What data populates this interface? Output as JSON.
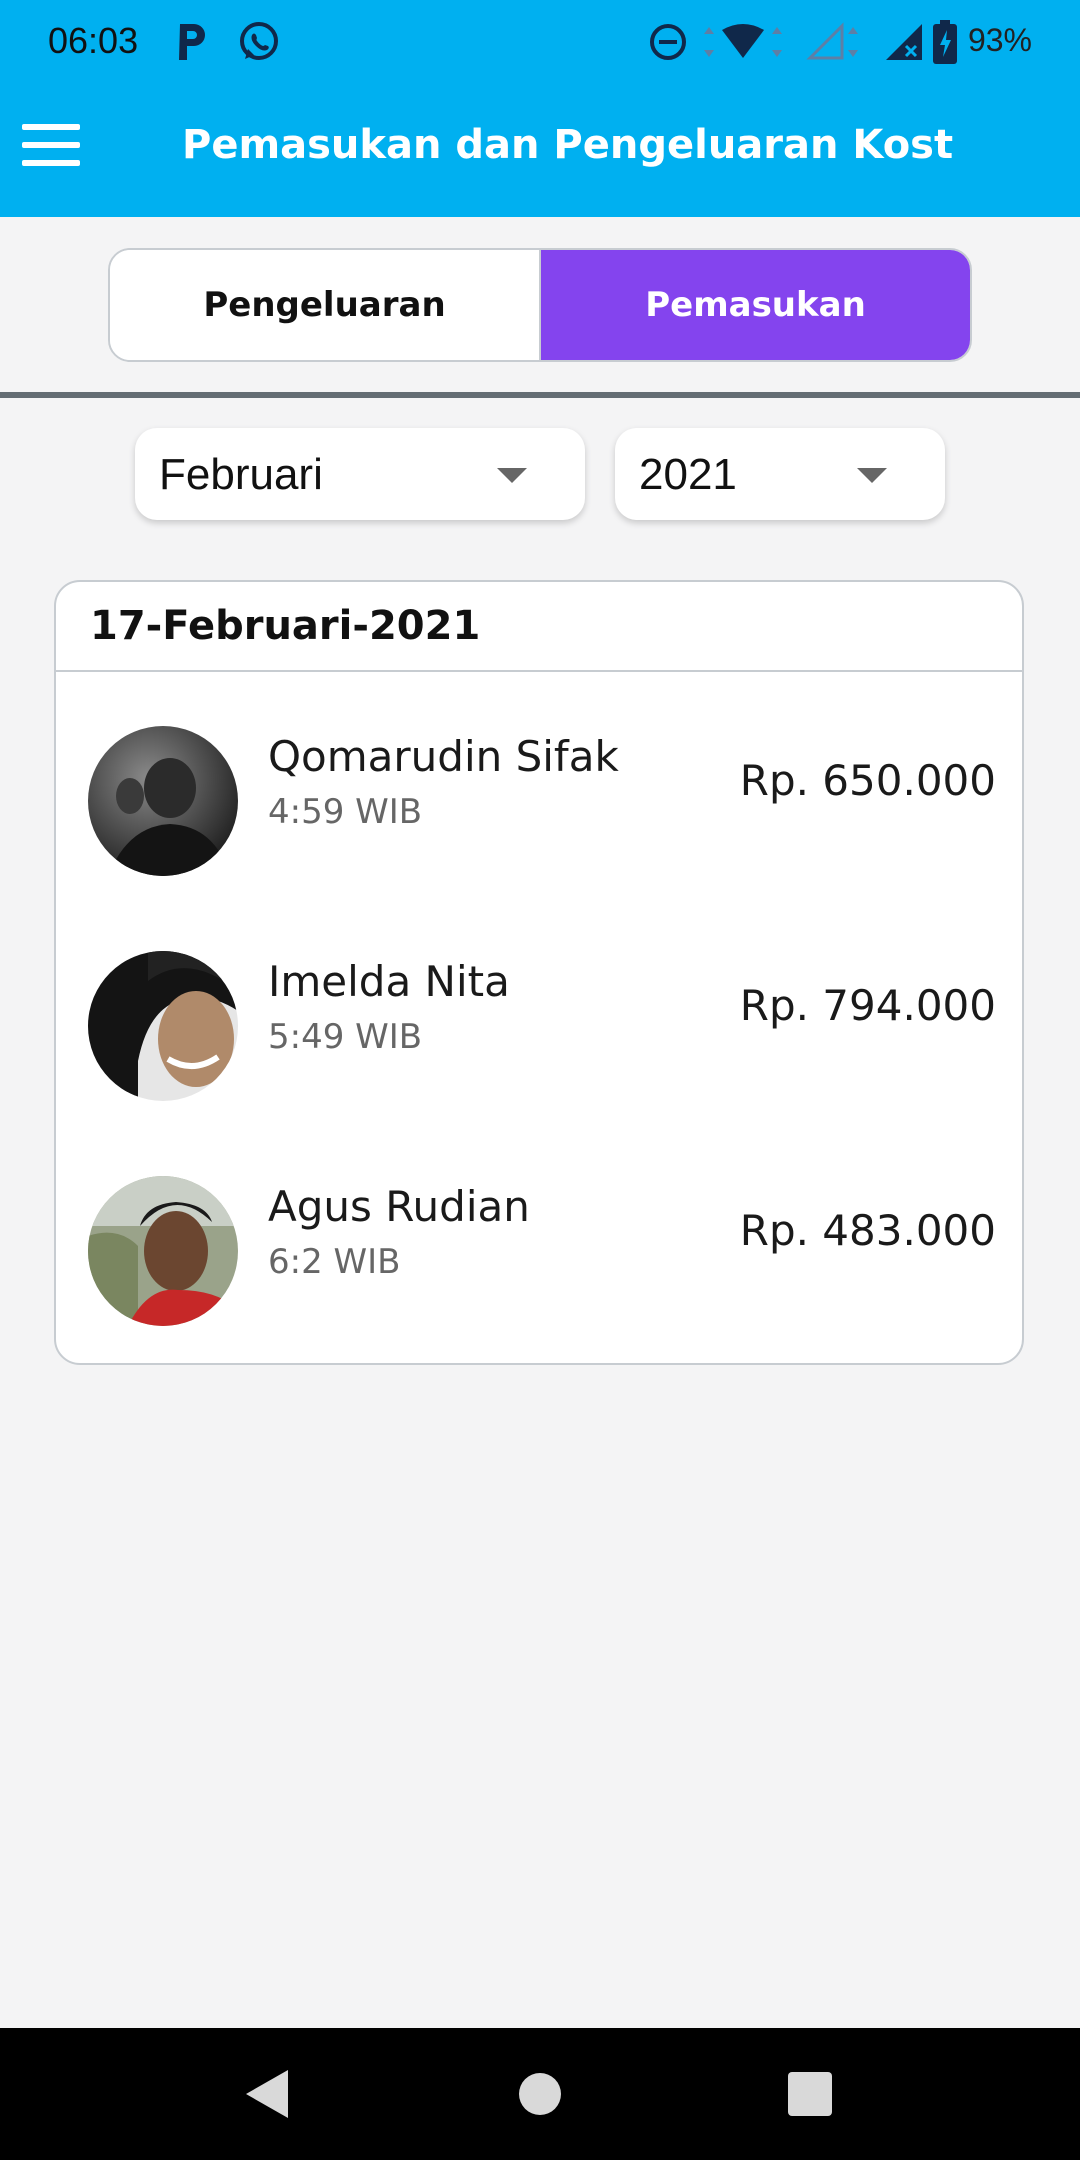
{
  "status_bar": {
    "time": "06:03",
    "battery_percent": "93%",
    "icons": [
      "parking-app-icon",
      "whatsapp-icon",
      "do-not-disturb-icon",
      "wifi-icon",
      "signal-empty-icon",
      "signal-no-data-icon",
      "battery-charging-icon"
    ]
  },
  "app_bar": {
    "title": "Pemasukan dan Pengeluaran Kost",
    "menu_icon": "hamburger-menu-icon"
  },
  "tabs": {
    "expense_label": "Pengeluaran",
    "income_label": "Pemasukan",
    "active": "Pemasukan"
  },
  "filters": {
    "month": "Februari",
    "year": "2021"
  },
  "card": {
    "date": "17-Februari-2021",
    "entries": [
      {
        "name": "Qomarudin Sifak",
        "time": "4:59 WIB",
        "amount": "Rp. 650.000"
      },
      {
        "name": "Imelda Nita",
        "time": "5:49 WIB",
        "amount": "Rp. 794.000"
      },
      {
        "name": "Agus Rudian",
        "time": "6:2 WIB",
        "amount": "Rp. 483.000"
      }
    ]
  },
  "nav_bar": {
    "icons": [
      "back-icon",
      "home-icon",
      "recents-icon"
    ]
  },
  "colors": {
    "primary": "#00b0f0",
    "accent": "#8444ee",
    "divider": "#646d73"
  }
}
